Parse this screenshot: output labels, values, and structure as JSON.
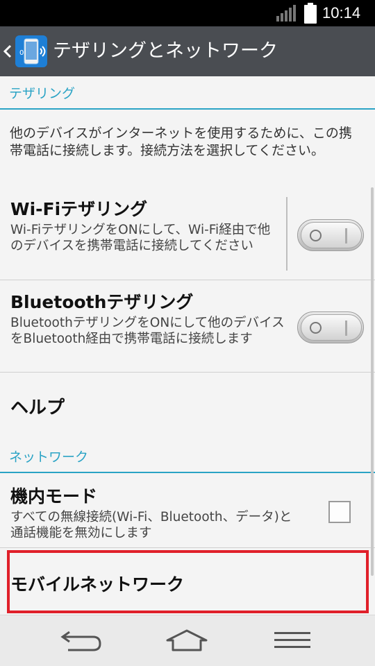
{
  "status_bar": {
    "time": "10:14"
  },
  "action_bar": {
    "title": "テザリングとネットワーク"
  },
  "tethering_section": {
    "header": "テザリング",
    "description": "他のデバイスがインターネットを使用するために、この携帯電話に接続します。接続方法を選択してください。",
    "wifi": {
      "title": "Wi-Fiテザリング",
      "summary": "Wi-FiテザリングをONにして、Wi-Fi経由で他のデバイスを携帯電話に接続してください",
      "enabled": false
    },
    "bluetooth": {
      "title": "Bluetoothテザリング",
      "summary": "BluetoothテザリングをONにして他のデバイスをBluetooth経由で携帯電話に接続します",
      "enabled": false
    },
    "help": {
      "title": "ヘルプ"
    }
  },
  "network_section": {
    "header": "ネットワーク",
    "airplane": {
      "title": "機内モード",
      "summary": "すべての無線接続(Wi-Fi、Bluetooth、データ)と通話機能を無効にします",
      "checked": false
    },
    "mobile_network": {
      "title": "モバイルネットワーク"
    }
  },
  "colors": {
    "accent": "#2aa3c5",
    "action_bar": "#4a4d52",
    "highlight": "#e0202a"
  }
}
